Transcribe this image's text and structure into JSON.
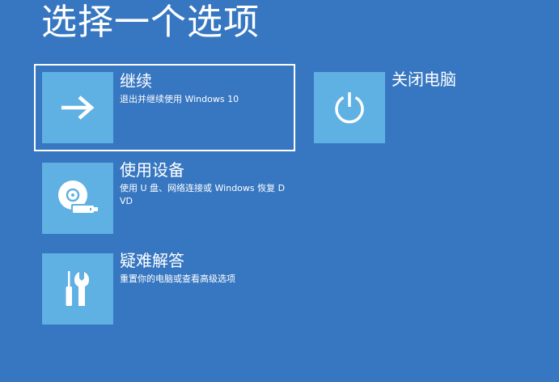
{
  "page": {
    "title": "选择一个选项"
  },
  "options": {
    "continue": {
      "title": "继续",
      "description": "退出并继续使用 Windows 10",
      "icon": "arrow-right-icon",
      "selected": true
    },
    "use_device": {
      "title": "使用设备",
      "description": "使用 U 盘、网络连接或 Windows 恢复 DVD",
      "icon": "disc-drive-icon"
    },
    "troubleshoot": {
      "title": "疑难解答",
      "description": "重置你的电脑或查看高级选项",
      "icon": "tools-icon"
    },
    "shutdown": {
      "title": "关闭电脑",
      "icon": "power-icon"
    }
  },
  "colors": {
    "background": "#3777c1",
    "tile": "#5fb0e3",
    "text": "#ffffff",
    "selection_border": "#ffffff"
  }
}
